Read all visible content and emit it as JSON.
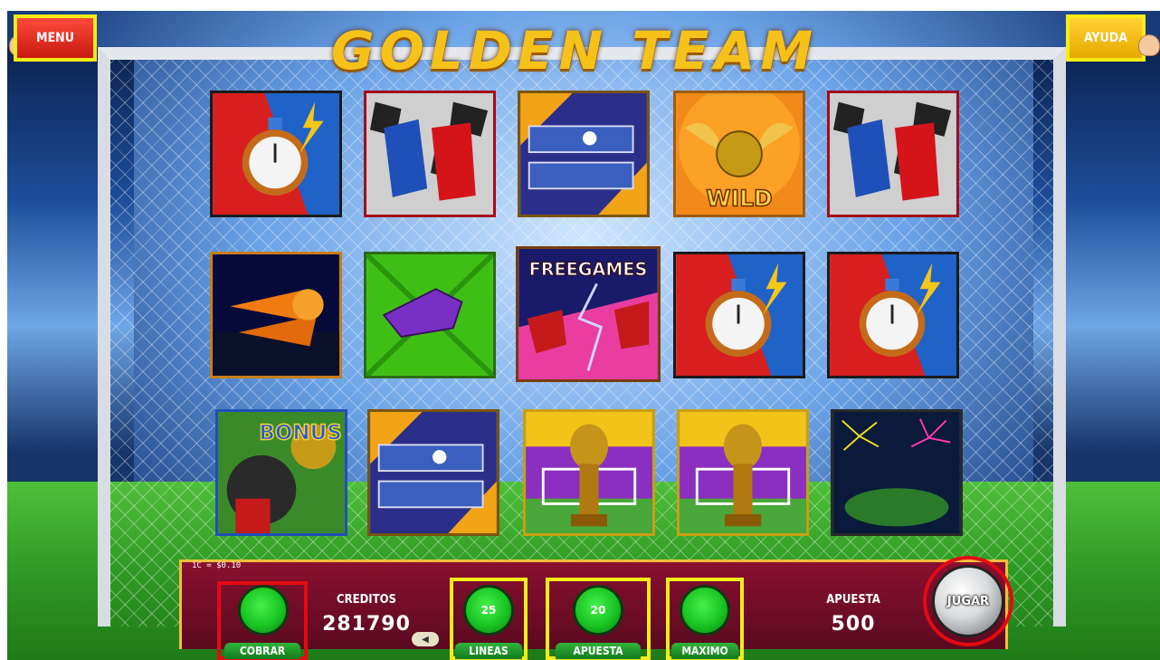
{
  "game": {
    "title": "GOLDEN TEAM",
    "menu_label": "MENU",
    "help_label": "AYUDA",
    "denomination": "1C = $0.10",
    "cobrar_label": "COBRAR",
    "creditos_label": "CREDITOS",
    "creditos_value": "281790",
    "lineas_label": "LINEAS",
    "lineas_value": "25",
    "apuesta_button_label": "APUESTA",
    "apuesta_button_value": "20",
    "maximo_label": "MAXIMO",
    "apuesta_label": "APUESTA",
    "apuesta_value": "500",
    "jugar_label": "JUGAR"
  },
  "symbol_text": {
    "wild": "WILD",
    "freegames": "FREEGAMES",
    "bonus": "BONUS"
  },
  "reels": [
    [
      "stopwatch",
      "gloves",
      "tickets",
      "wild-ball",
      "gloves"
    ],
    [
      "horns",
      "whistle",
      "freegames",
      "stopwatch",
      "stopwatch"
    ],
    [
      "bonus",
      "tickets",
      "trophy",
      "trophy",
      "fireworks"
    ]
  ],
  "colors": {
    "highlight_red": "#e40a12",
    "highlight_yellow": "#f5ec19",
    "button_green": "#19c522",
    "panel": "#7a0e28",
    "title_gold": "#f6c21a"
  }
}
